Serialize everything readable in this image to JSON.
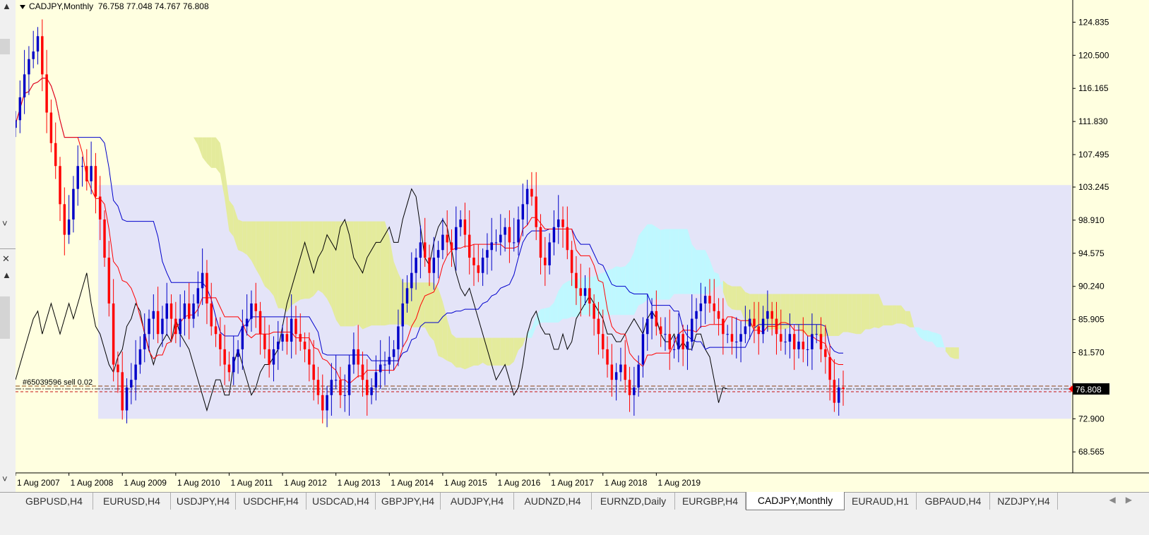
{
  "window": {
    "symbol_title": "CADJPY,Monthly",
    "ohlc": "76.758 77.048 74.767 76.808"
  },
  "price_badge": "76.808",
  "order_label": "#65039596 sell 0.02",
  "tabs": [
    {
      "label": "GBPUSD,H4",
      "active": false
    },
    {
      "label": "EURUSD,H4",
      "active": false
    },
    {
      "label": "USDJPY,H4",
      "active": false
    },
    {
      "label": "USDCHF,H4",
      "active": false
    },
    {
      "label": "USDCAD,H4",
      "active": false
    },
    {
      "label": "GBPJPY,H4",
      "active": false
    },
    {
      "label": "AUDJPY,H4",
      "active": false
    },
    {
      "label": "AUDNZD,H4",
      "active": false
    },
    {
      "label": "EURNZD,Daily",
      "active": false
    },
    {
      "label": "EURGBP,H4",
      "active": false
    },
    {
      "label": "CADJPY,Monthly",
      "active": true
    },
    {
      "label": "EURAUD,H1",
      "active": false
    },
    {
      "label": "GBPAUD,H4",
      "active": false
    },
    {
      "label": "NZDJPY,H4",
      "active": false
    }
  ],
  "colors": {
    "background": "#ffffe0",
    "bull_candle": "#0000c8",
    "bear_candle": "#ff0000",
    "tenkan": "#ff0000",
    "kijun": "#0000cc",
    "chikou": "#000000",
    "cloud_bull": "#bff8ff",
    "cloud_bull_overlap": "#cce6f2",
    "cloud_bear": "#e4eb9c",
    "cloud_bear_overlap": "#d2e5b6",
    "zone": "#e4e4f8",
    "badge": "#000000"
  },
  "chart_data": {
    "type": "candlestick",
    "symbol": "CADJPY",
    "timeframe": "Monthly",
    "ylim": [
      66.0,
      127.0
    ],
    "y_ticks": [
      124.835,
      120.5,
      116.165,
      111.83,
      107.495,
      103.245,
      98.91,
      94.575,
      90.24,
      85.905,
      81.57,
      76.808,
      72.9,
      68.565
    ],
    "x_labels": [
      "1 Aug 2007",
      "1 Aug 2008",
      "1 Aug 2009",
      "1 Aug 2010",
      "1 Aug 2011",
      "1 Aug 2012",
      "1 Aug 2013",
      "1 Aug 2014",
      "1 Aug 2015",
      "1 Aug 2016",
      "1 Aug 2017",
      "1 Aug 2018",
      "1 Aug 2019"
    ],
    "last_price": 76.808,
    "closes": [
      112,
      115,
      118,
      120,
      121,
      123,
      118,
      113,
      109,
      106,
      101,
      97,
      99,
      103,
      106,
      106,
      104,
      106,
      102,
      99,
      94,
      88,
      80,
      79,
      74,
      77,
      78,
      80,
      82,
      84,
      86,
      87,
      84,
      86,
      88,
      86,
      84,
      86,
      88,
      86,
      88,
      90,
      92,
      88,
      85,
      84,
      82,
      80,
      79,
      81,
      82,
      85,
      86,
      88,
      87,
      84,
      82,
      80,
      82,
      83,
      84,
      83,
      86,
      84,
      83,
      82,
      80,
      78,
      76,
      74,
      76,
      78,
      78,
      76,
      76,
      80,
      82,
      80,
      78,
      76,
      77,
      79,
      80,
      80,
      81,
      82,
      85,
      88,
      90,
      92,
      94,
      96,
      94,
      92,
      94,
      95,
      97,
      96,
      95,
      98,
      99,
      97,
      94,
      93,
      92,
      94,
      95,
      96,
      96,
      97,
      98,
      96,
      96,
      99,
      101,
      103,
      102,
      98,
      94,
      93,
      96,
      98,
      99,
      98,
      95,
      92,
      90,
      89,
      90,
      88,
      86,
      84,
      82,
      80,
      78,
      79,
      80,
      78,
      76,
      77,
      80,
      84,
      86,
      87,
      85,
      84,
      84,
      82,
      82,
      84,
      82,
      83,
      86,
      87,
      88,
      89,
      88,
      87,
      86,
      84,
      84,
      83,
      83,
      84,
      85,
      86,
      85,
      84,
      86,
      87,
      86,
      84,
      83,
      83,
      84,
      82,
      83,
      82,
      82,
      84,
      84,
      82,
      81,
      78,
      75,
      77,
      76.808
    ],
    "indicators": [
      "Tenkan-sen",
      "Kijun-sen",
      "Chikou Span",
      "Senkou Span A",
      "Senkou Span B"
    ]
  }
}
